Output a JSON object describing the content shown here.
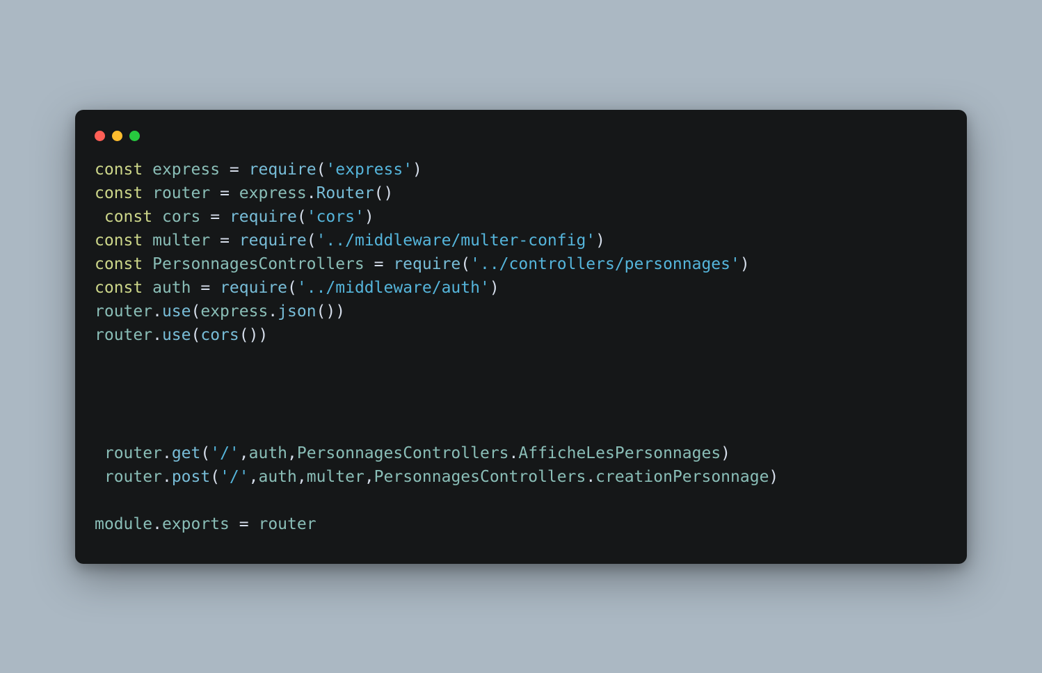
{
  "colors": {
    "bg": "#abb8c3",
    "window": "#151718",
    "red": "#ff5f56",
    "yellow": "#ffbd2e",
    "green": "#27c93f",
    "keyword": "#cdd78a",
    "ident": "#8abeb7",
    "func": "#78bdd8",
    "string": "#55b5db",
    "punct": "#d6deeb"
  },
  "code": {
    "lines": [
      {
        "indent": 0,
        "t": [
          {
            "c": "kw",
            "v": "const"
          },
          {
            "c": "sp",
            "v": " "
          },
          {
            "c": "id",
            "v": "express"
          },
          {
            "c": "sp",
            "v": " "
          },
          {
            "c": "op",
            "v": "="
          },
          {
            "c": "sp",
            "v": " "
          },
          {
            "c": "fn",
            "v": "require"
          },
          {
            "c": "pn",
            "v": "("
          },
          {
            "c": "str",
            "v": "'express'"
          },
          {
            "c": "pn",
            "v": ")"
          }
        ]
      },
      {
        "indent": 0,
        "t": [
          {
            "c": "kw",
            "v": "const"
          },
          {
            "c": "sp",
            "v": " "
          },
          {
            "c": "id",
            "v": "router"
          },
          {
            "c": "sp",
            "v": " "
          },
          {
            "c": "op",
            "v": "="
          },
          {
            "c": "sp",
            "v": " "
          },
          {
            "c": "id",
            "v": "express"
          },
          {
            "c": "pn",
            "v": "."
          },
          {
            "c": "fn",
            "v": "Router"
          },
          {
            "c": "pn",
            "v": "()"
          }
        ]
      },
      {
        "indent": 1,
        "t": [
          {
            "c": "kw",
            "v": "const"
          },
          {
            "c": "sp",
            "v": " "
          },
          {
            "c": "id",
            "v": "cors"
          },
          {
            "c": "sp",
            "v": " "
          },
          {
            "c": "op",
            "v": "="
          },
          {
            "c": "sp",
            "v": " "
          },
          {
            "c": "fn",
            "v": "require"
          },
          {
            "c": "pn",
            "v": "("
          },
          {
            "c": "str",
            "v": "'cors'"
          },
          {
            "c": "pn",
            "v": ")"
          }
        ]
      },
      {
        "indent": 0,
        "t": [
          {
            "c": "kw",
            "v": "const"
          },
          {
            "c": "sp",
            "v": " "
          },
          {
            "c": "id",
            "v": "multer"
          },
          {
            "c": "sp",
            "v": " "
          },
          {
            "c": "op",
            "v": "="
          },
          {
            "c": "sp",
            "v": " "
          },
          {
            "c": "fn",
            "v": "require"
          },
          {
            "c": "pn",
            "v": "("
          },
          {
            "c": "str",
            "v": "'../middleware/multer-config'"
          },
          {
            "c": "pn",
            "v": ")"
          }
        ]
      },
      {
        "indent": 0,
        "t": [
          {
            "c": "kw",
            "v": "const"
          },
          {
            "c": "sp",
            "v": " "
          },
          {
            "c": "id",
            "v": "PersonnagesControllers"
          },
          {
            "c": "sp",
            "v": " "
          },
          {
            "c": "op",
            "v": "="
          },
          {
            "c": "sp",
            "v": " "
          },
          {
            "c": "fn",
            "v": "require"
          },
          {
            "c": "pn",
            "v": "("
          },
          {
            "c": "str",
            "v": "'../controllers/personnages'"
          },
          {
            "c": "pn",
            "v": ")"
          }
        ]
      },
      {
        "indent": 0,
        "t": [
          {
            "c": "kw",
            "v": "const"
          },
          {
            "c": "sp",
            "v": " "
          },
          {
            "c": "id",
            "v": "auth"
          },
          {
            "c": "sp",
            "v": " "
          },
          {
            "c": "op",
            "v": "="
          },
          {
            "c": "sp",
            "v": " "
          },
          {
            "c": "fn",
            "v": "require"
          },
          {
            "c": "pn",
            "v": "("
          },
          {
            "c": "str",
            "v": "'../middleware/auth'"
          },
          {
            "c": "pn",
            "v": ")"
          }
        ]
      },
      {
        "indent": 0,
        "t": [
          {
            "c": "id",
            "v": "router"
          },
          {
            "c": "pn",
            "v": "."
          },
          {
            "c": "fn",
            "v": "use"
          },
          {
            "c": "pn",
            "v": "("
          },
          {
            "c": "id",
            "v": "express"
          },
          {
            "c": "pn",
            "v": "."
          },
          {
            "c": "fn",
            "v": "json"
          },
          {
            "c": "pn",
            "v": "())"
          }
        ]
      },
      {
        "indent": 0,
        "t": [
          {
            "c": "id",
            "v": "router"
          },
          {
            "c": "pn",
            "v": "."
          },
          {
            "c": "fn",
            "v": "use"
          },
          {
            "c": "pn",
            "v": "("
          },
          {
            "c": "fn",
            "v": "cors"
          },
          {
            "c": "pn",
            "v": "())"
          }
        ]
      },
      {
        "blank": true
      },
      {
        "blank": true
      },
      {
        "blank": true
      },
      {
        "blank": true
      },
      {
        "indent": 1,
        "t": [
          {
            "c": "id",
            "v": "router"
          },
          {
            "c": "pn",
            "v": "."
          },
          {
            "c": "fn",
            "v": "get"
          },
          {
            "c": "pn",
            "v": "("
          },
          {
            "c": "str",
            "v": "'/'"
          },
          {
            "c": "pn",
            "v": ","
          },
          {
            "c": "id",
            "v": "auth"
          },
          {
            "c": "pn",
            "v": ","
          },
          {
            "c": "id",
            "v": "PersonnagesControllers"
          },
          {
            "c": "pn",
            "v": "."
          },
          {
            "c": "id",
            "v": "AfficheLesPersonnages"
          },
          {
            "c": "pn",
            "v": ")"
          }
        ]
      },
      {
        "indent": 1,
        "t": [
          {
            "c": "id",
            "v": "router"
          },
          {
            "c": "pn",
            "v": "."
          },
          {
            "c": "fn",
            "v": "post"
          },
          {
            "c": "pn",
            "v": "("
          },
          {
            "c": "str",
            "v": "'/'"
          },
          {
            "c": "pn",
            "v": ","
          },
          {
            "c": "id",
            "v": "auth"
          },
          {
            "c": "pn",
            "v": ","
          },
          {
            "c": "id",
            "v": "multer"
          },
          {
            "c": "pn",
            "v": ","
          },
          {
            "c": "id",
            "v": "PersonnagesControllers"
          },
          {
            "c": "pn",
            "v": "."
          },
          {
            "c": "id",
            "v": "creationPersonnage"
          },
          {
            "c": "pn",
            "v": ")"
          }
        ]
      },
      {
        "blank": true
      },
      {
        "indent": 0,
        "t": [
          {
            "c": "id",
            "v": "module"
          },
          {
            "c": "pn",
            "v": "."
          },
          {
            "c": "id",
            "v": "exports"
          },
          {
            "c": "sp",
            "v": " "
          },
          {
            "c": "op",
            "v": "="
          },
          {
            "c": "sp",
            "v": " "
          },
          {
            "c": "id",
            "v": "router"
          }
        ]
      }
    ]
  }
}
